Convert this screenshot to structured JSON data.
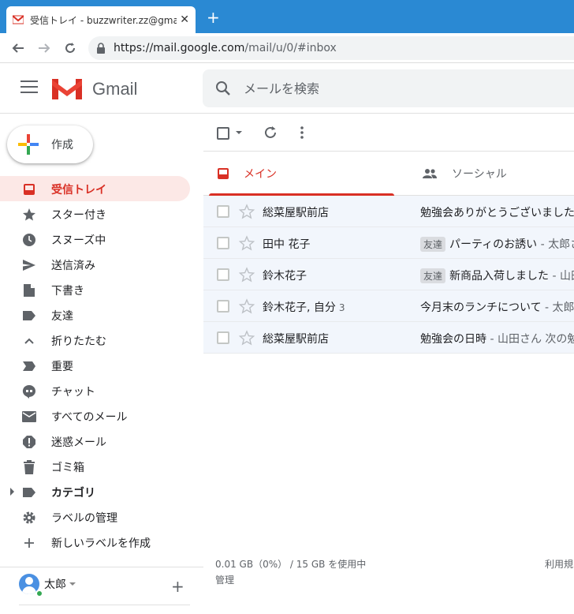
{
  "browser": {
    "tab_title": "受信トレイ - buzzwriter.zz@gmail.c",
    "new_tab": "+",
    "close_tab": "✕",
    "url_host": "https://mail.google.com",
    "url_path": "/mail/u/0/#inbox"
  },
  "header": {
    "app_name": "Gmail",
    "search_placeholder": "メールを検索"
  },
  "compose": {
    "label": "作成"
  },
  "sidebar": {
    "items": [
      {
        "label": "受信トレイ",
        "icon": "inbox-icon",
        "active": true
      },
      {
        "label": "スター付き",
        "icon": "star-icon"
      },
      {
        "label": "スヌーズ中",
        "icon": "clock-icon"
      },
      {
        "label": "送信済み",
        "icon": "send-icon"
      },
      {
        "label": "下書き",
        "icon": "draft-icon"
      },
      {
        "label": "友達",
        "icon": "label-icon"
      },
      {
        "label": "折りたたむ",
        "icon": "chevron-up-icon"
      },
      {
        "label": "重要",
        "icon": "important-icon"
      },
      {
        "label": "チャット",
        "icon": "chat-icon"
      },
      {
        "label": "すべてのメール",
        "icon": "mail-icon"
      },
      {
        "label": "迷惑メール",
        "icon": "spam-icon"
      },
      {
        "label": "ゴミ箱",
        "icon": "trash-icon"
      },
      {
        "label": "カテゴリ",
        "icon": "label-icon",
        "bold": true,
        "expandable": true
      },
      {
        "label": "ラベルの管理",
        "icon": "gear-icon"
      },
      {
        "label": "新しいラベルを作成",
        "icon": "plus-icon"
      }
    ]
  },
  "user": {
    "name": "太郎",
    "add": "+"
  },
  "tabs": {
    "primary": "メイン",
    "social": "ソーシャル"
  },
  "messages": [
    {
      "sender": "総菜屋駅前店",
      "count": "",
      "label": "",
      "subject": "勉強会ありがとうございました",
      "snippet": ""
    },
    {
      "sender": "田中 花子",
      "count": "",
      "label": "友達",
      "subject": "パーティのお誘い",
      "snippet": " - 太郎さ"
    },
    {
      "sender": "鈴木花子",
      "count": "",
      "label": "友達",
      "subject": "新商品入荷しました",
      "snippet": " - 山田"
    },
    {
      "sender": "鈴木花子, 自分",
      "count": "3",
      "label": "",
      "subject": "今月末のランチについて",
      "snippet": " - 太郎さ"
    },
    {
      "sender": "総菜屋駅前店",
      "count": "",
      "label": "",
      "subject": "勉強会の日時",
      "snippet": " - 山田さん 次の勉"
    }
  ],
  "footer": {
    "storage": "0.01 GB（0%） / 15 GB を使用中",
    "manage": "管理",
    "terms": "利用規"
  },
  "colors": {
    "accent_red": "#d93025",
    "active_bg": "#fce8e6",
    "chrome_blue": "#2a89d3"
  }
}
